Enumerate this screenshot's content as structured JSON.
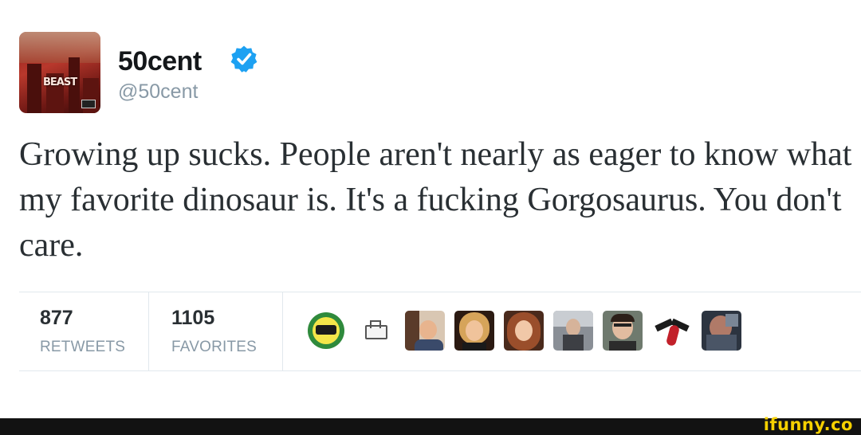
{
  "tweet": {
    "display_name": "50cent",
    "handle": "@50cent",
    "text": "Growing up sucks. People aren't nearly as eager to know what my favorite dinosaur is. It's a fucking Gorgosaurus. You don't care.",
    "avatar_album_text": "BEAST",
    "verified": true
  },
  "stats": {
    "retweets": {
      "count": "877",
      "label": "RETWEETS"
    },
    "favorites": {
      "count": "1105",
      "label": "FAVORITES"
    }
  },
  "favorited_by": [
    "avatar-cup-logo-icon",
    "avatar-sketch-icon",
    "avatar-person-icon",
    "avatar-person-icon",
    "avatar-person-icon",
    "avatar-person-icon",
    "avatar-person-icon",
    "avatar-bird-icon",
    "avatar-person-icon"
  ],
  "watermark": "ifunny.co",
  "colors": {
    "verified_blue": "#1da1f2",
    "name_text": "#14171a",
    "muted_text": "#8899a6",
    "body_text": "#292f33",
    "watermark_yellow": "#f6d100"
  }
}
